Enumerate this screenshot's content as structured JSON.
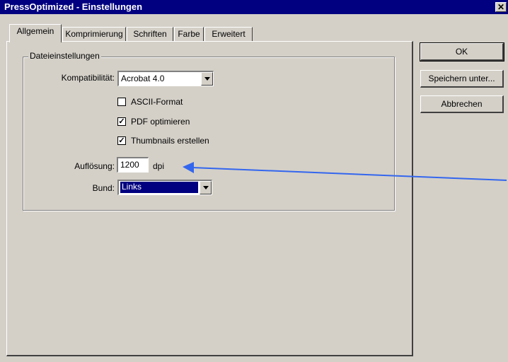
{
  "window": {
    "title": "PressOptimized - Einstellungen",
    "close_glyph": "✕"
  },
  "tabs": [
    {
      "label": "Allgemein",
      "active": true
    },
    {
      "label": "Komprimierung"
    },
    {
      "label": "Schriften"
    },
    {
      "label": "Farbe"
    },
    {
      "label": "Erweitert"
    }
  ],
  "group": {
    "title": "Dateieinstellungen"
  },
  "compat": {
    "label": "Kompatibilität:",
    "value": "Acrobat 4.0"
  },
  "checks": [
    {
      "label": "ASCII-Format",
      "checked": false
    },
    {
      "label": "PDF optimieren",
      "checked": true
    },
    {
      "label": "Thumbnails erstellen",
      "checked": true
    }
  ],
  "resolution": {
    "label": "Auflösung:",
    "value": "1200",
    "unit": "dpi"
  },
  "bund": {
    "label": "Bund:",
    "value": "Links"
  },
  "buttons": {
    "ok": "OK",
    "save_as": "Speichern unter...",
    "cancel": "Abbrechen"
  },
  "colors": {
    "titlebar": "#000080",
    "face": "#d4d0c8",
    "arrow": "#3366ee"
  }
}
